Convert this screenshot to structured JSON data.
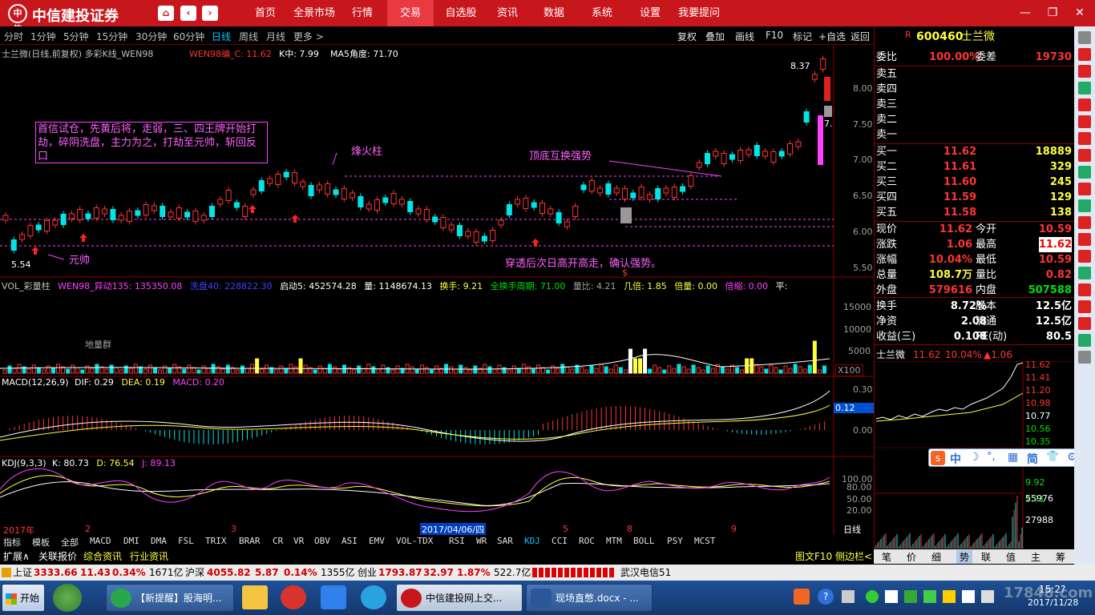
{
  "app": {
    "title": "中信建投证券",
    "logo": "中信",
    "menu": [
      "首页",
      "全景市场",
      "行情",
      "交易",
      "自选股",
      "资讯",
      "数据",
      "系统",
      "设置",
      "我要提问"
    ],
    "active_menu": "交易"
  },
  "period_bar": {
    "tabs": [
      "分时",
      "1分钟",
      "5分钟",
      "15分钟",
      "30分钟",
      "60分钟",
      "日线",
      "周线",
      "月线",
      "更多 >"
    ],
    "selected": "日线",
    "tools": [
      "复权",
      "叠加",
      "画线",
      "F10",
      "标记",
      "+自选",
      "返回"
    ]
  },
  "kline": {
    "title": "士兰微(日线,前复权) 多彩K线_WEN98",
    "ind1": "WEN98编_C: 11.62",
    "ind2": "K中: 7.99",
    "ind3": "MA5角度: 71.70",
    "y_labels": [
      "8.00",
      "7.50",
      "7.00",
      "6.50",
      "6.00",
      "5.50"
    ],
    "high_label": "8.37",
    "low_label": "5.54",
    "price_tag": "7.",
    "note": "首信试仓，先黄后将，走弱，三、四王牌开始打劫，碎阴洗盘，主力为之，打劫至元帅，斩回反口",
    "ann_fire": "烽火柱",
    "ann_top": "顶底互换强势",
    "ann_break": "穿透后次日高开高走，确认强势。",
    "ann_marshal": "元帅",
    "s_mark": "$"
  },
  "volume": {
    "title": "VOL_彩量柱",
    "v1": "WEN98_异动135: 135350.08",
    "v2": "洗盘40: 228822.30",
    "v3": "启动5: 452574.28",
    "v4": "量: 1148674.13",
    "v5": "换手: 9.21",
    "v6": "全换手周期: 71.00",
    "v7": "量比: 4.21",
    "v8": "几倍: 1.85",
    "v9": "倍量: 0.00",
    "v10": "倍缩: 0.00",
    "v11": "平:",
    "ground": "地量群",
    "y_labels": [
      "15000",
      "10000",
      "5000"
    ],
    "unit": "X100"
  },
  "macd": {
    "title": "MACD(12,26,9)",
    "dif": "DIF: 0.29",
    "dea": "DEA: 0.19",
    "macd": "MACD: 0.20",
    "y_labels": [
      "0.30",
      "0.00"
    ],
    "tag": "0.12"
  },
  "kdj": {
    "title": "KDJ(9,3,3)",
    "k": "K: 80.73",
    "d": "D: 76.54",
    "j": "J: 89.13",
    "y_labels": [
      "100.00",
      "80.00",
      "50.00",
      "20.00"
    ]
  },
  "xaxis": {
    "year": "2017年",
    "months": [
      "2",
      "3",
      "5",
      "8",
      "9"
    ],
    "date_tag": "2017/04/06/四",
    "period": "日线"
  },
  "indicator_tabs": [
    "指标",
    "模板",
    "全部",
    "MACD",
    "DMI",
    "DMA",
    "FSL",
    "TRIX",
    "BRAR",
    "CR",
    "VR",
    "OBV",
    "ASI",
    "EMV",
    "VOL-TDX",
    "RSI",
    "WR",
    "SAR",
    "KDJ",
    "CCI",
    "ROC",
    "MTM",
    "BOLL",
    "PSY",
    "MCST"
  ],
  "indicator_selected": "KDJ",
  "bottom_tabs": [
    "扩展∧",
    "关联报价",
    "综合资讯",
    "行业资讯"
  ],
  "bottom_right": [
    "图文F10",
    "侧边栏<"
  ],
  "quote": {
    "code": "600460",
    "name": "士兰微",
    "r_mark": "R",
    "weibi_label": "委比",
    "weibi": "100.00%",
    "weicha_label": "委差",
    "weicha": "19730",
    "sell": [
      "卖五",
      "卖四",
      "卖三",
      "卖二",
      "卖一"
    ],
    "buy": [
      {
        "label": "买一",
        "price": "11.62",
        "vol": "18889"
      },
      {
        "label": "买二",
        "price": "11.61",
        "vol": "329"
      },
      {
        "label": "买三",
        "price": "11.60",
        "vol": "245"
      },
      {
        "label": "买四",
        "price": "11.59",
        "vol": "129"
      },
      {
        "label": "买五",
        "price": "11.58",
        "vol": "138"
      }
    ],
    "stats": [
      {
        "l": "现价",
        "v": "11.62",
        "l2": "今开",
        "v2": "10.59"
      },
      {
        "l": "涨跌",
        "v": "1.06",
        "l2": "最高",
        "v2": "11.62"
      },
      {
        "l": "涨幅",
        "v": "10.04%",
        "l2": "最低",
        "v2": "10.59"
      },
      {
        "l": "总量",
        "v": "108.7万",
        "l2": "量比",
        "v2": "0.82"
      },
      {
        "l": "外盘",
        "v": "579616",
        "l2": "内盘",
        "v2": "507588"
      }
    ],
    "stats2": [
      {
        "l": "换手",
        "v": "8.72%",
        "l2": "股本",
        "v2": "12.5亿"
      },
      {
        "l": "净资",
        "v": "2.08",
        "l2": "流通",
        "v2": "12.5亿"
      },
      {
        "l": "收益(三)",
        "v": "0.108",
        "l2": "PE(动)",
        "v2": "80.5"
      }
    ],
    "mini_title": "士兰微",
    "mini_price": "11.62",
    "mini_pct": "10.04%",
    "mini_chg": "▲1.06",
    "mini_y": [
      "11.62",
      "11.41",
      "11.20",
      "10.98",
      "10.77",
      "10.56",
      "10.35",
      "9.92",
      "9.71"
    ],
    "mini_vol": [
      "55976",
      "27988"
    ],
    "mini_tabs": [
      "笔",
      "价",
      "细",
      "势",
      "联",
      "值",
      "主",
      "筹"
    ],
    "mini_tab_selected": "势"
  },
  "ime": {
    "items": [
      "中",
      "☽",
      "°,",
      "▦",
      "简",
      "👕",
      "⚙"
    ]
  },
  "statusbar": {
    "sh_label": "上证",
    "sh": "3333.66",
    "sh_chg": "11.43",
    "sh_pct": "0.34%",
    "sh_amt": "1671亿",
    "hs_label": "沪深",
    "hs": "4055.82",
    "hs_chg": "5.87",
    "hs_pct": "0.14%",
    "hs_amt": "1355亿",
    "cy_label": "创业",
    "cy": "1793.87",
    "cy_chg": "32.97",
    "cy_pct": "1.87%",
    "cy_amt": "522.7亿",
    "news": "武汉电信51"
  },
  "taskbar": {
    "start": "开始",
    "tasks": [
      "【新提醒】股海明...",
      "",
      "",
      "",
      "",
      "中信建投网上交...",
      "现场直憋.docx - ..."
    ],
    "clock_time": "15:2?",
    "clock_date": "2017/11/28",
    "watermark": "17848.com"
  },
  "sidebar_icons": [
    "up-arrow-icon",
    "chart-icon",
    "chart2-icon",
    "list-icon",
    "grid-icon",
    "line-icon",
    "bar-icon",
    "pie-icon",
    "table-icon",
    "flag-icon",
    "lock-icon",
    "doc-icon",
    "f10-icon",
    "fz-icon",
    "clock-icon",
    "rsi-icon",
    "book-icon",
    "rsi2-icon",
    "move-icon",
    "down-icon"
  ]
}
